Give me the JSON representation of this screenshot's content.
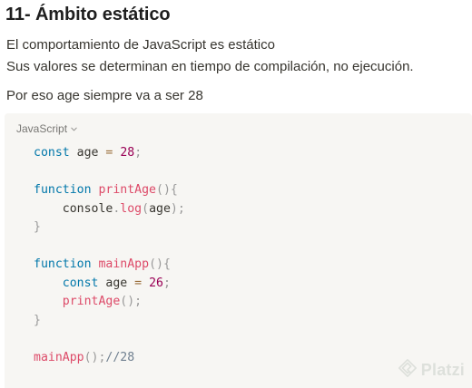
{
  "heading": "11- Ámbito estático",
  "paragraphs": {
    "line1": "El comportamiento de JavaScript es estático",
    "line2": "Sus valores se determinan en tiempo de compilación, no ejecución.",
    "line3": "Por eso age siempre va a ser 28"
  },
  "code_block": {
    "language": "JavaScript",
    "lines": [
      [
        {
          "t": "const",
          "c": "kw"
        },
        {
          "t": " age ",
          "c": "plain"
        },
        {
          "t": "=",
          "c": "op"
        },
        {
          "t": " ",
          "c": "plain"
        },
        {
          "t": "28",
          "c": "num"
        },
        {
          "t": ";",
          "c": "pn"
        }
      ],
      [],
      [
        {
          "t": "function",
          "c": "kw"
        },
        {
          "t": " ",
          "c": "plain"
        },
        {
          "t": "printAge",
          "c": "fn"
        },
        {
          "t": "(){",
          "c": "pn"
        }
      ],
      [
        {
          "t": "    console",
          "c": "plain"
        },
        {
          "t": ".",
          "c": "pn"
        },
        {
          "t": "log",
          "c": "fn"
        },
        {
          "t": "(",
          "c": "pn"
        },
        {
          "t": "age",
          "c": "plain"
        },
        {
          "t": ");",
          "c": "pn"
        }
      ],
      [
        {
          "t": "}",
          "c": "pn"
        }
      ],
      [],
      [
        {
          "t": "function",
          "c": "kw"
        },
        {
          "t": " ",
          "c": "plain"
        },
        {
          "t": "mainApp",
          "c": "fn"
        },
        {
          "t": "(){",
          "c": "pn"
        }
      ],
      [
        {
          "t": "    ",
          "c": "plain"
        },
        {
          "t": "const",
          "c": "kw"
        },
        {
          "t": " age ",
          "c": "plain"
        },
        {
          "t": "=",
          "c": "op"
        },
        {
          "t": " ",
          "c": "plain"
        },
        {
          "t": "26",
          "c": "num"
        },
        {
          "t": ";",
          "c": "pn"
        }
      ],
      [
        {
          "t": "    ",
          "c": "plain"
        },
        {
          "t": "printAge",
          "c": "fn"
        },
        {
          "t": "();",
          "c": "pn"
        }
      ],
      [
        {
          "t": "}",
          "c": "pn"
        }
      ],
      [],
      [
        {
          "t": "mainApp",
          "c": "fn"
        },
        {
          "t": "();",
          "c": "pn"
        },
        {
          "t": "//28",
          "c": "cm"
        }
      ]
    ]
  },
  "watermark": {
    "text": "Platzi",
    "icon": "platzi-logo-icon"
  }
}
